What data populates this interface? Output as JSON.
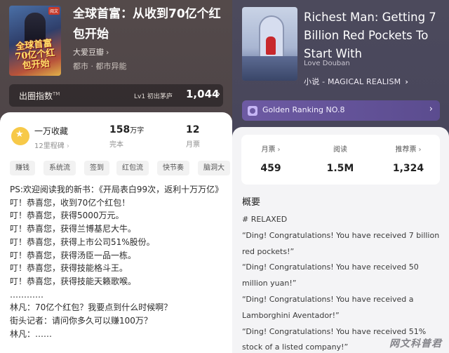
{
  "left": {
    "title": "全球首富：从收到70亿个红包开始",
    "cover_text": "全球首富 70亿个红包开始",
    "cover_badge": "阅文",
    "author": "大爱豆瓣",
    "genre": "都市 · 都市异能",
    "rank": {
      "label": "出圈指数",
      "tm": "TM",
      "level": "Lv1 初出茅庐",
      "value": "1,044"
    },
    "stats": {
      "collections": "一万收藏",
      "milestone": "12里程碑",
      "words": "158",
      "words_unit": "万字",
      "words_status": "完本",
      "monthly_tickets": "12",
      "monthly_label": "月票"
    },
    "tags": [
      "赚钱",
      "系统流",
      "签到",
      "红包流",
      "快节奏",
      "脑洞大"
    ],
    "synopsis": [
      "PS:欢迎阅读我的新书：《开局表白99次，返利十万万亿》",
      "叮！恭喜您，收到70亿个红包！",
      "叮！恭喜您，获得5000万元。",
      "叮！恭喜您，获得兰博基尼大牛。",
      "叮！恭喜您，获得上市公司51%股份。",
      "叮！恭喜您，获得汤臣一品一栋。",
      "叮！恭喜您，获得技能格斗王。",
      "叮！恭喜您，获得技能天籁歌喉。",
      "…………",
      "林凡：70亿个红包？我要点到什么时候啊？",
      "街头记者：请问你多久可以赚100万？",
      "林凡：……"
    ]
  },
  "right": {
    "title": "Richest Man: Getting 7 Billion Red Pockets To Start With",
    "author": "Love Douban",
    "genre": "小说 - MAGICAL REALISM",
    "golden": "Golden Ranking NO.8",
    "stats": [
      {
        "label": "月票",
        "value": "459",
        "chev": true
      },
      {
        "label": "阅读",
        "value": "1.5M",
        "chev": false
      },
      {
        "label": "推荐票",
        "value": "1,324",
        "chev": true
      }
    ],
    "section_title": "概要",
    "synopsis": [
      "# RELAXED",
      "“Ding! Congratulations! You have received 7 billion red pockets!”",
      "“Ding! Congratulations! You have received 50 million yuan!”",
      "“Ding! Congratulations! You have received a Lamborghini Aventador!”",
      "“Ding! Congratulations! You have received 51% stock of a listed company!”"
    ]
  },
  "watermark": "网文科普君"
}
